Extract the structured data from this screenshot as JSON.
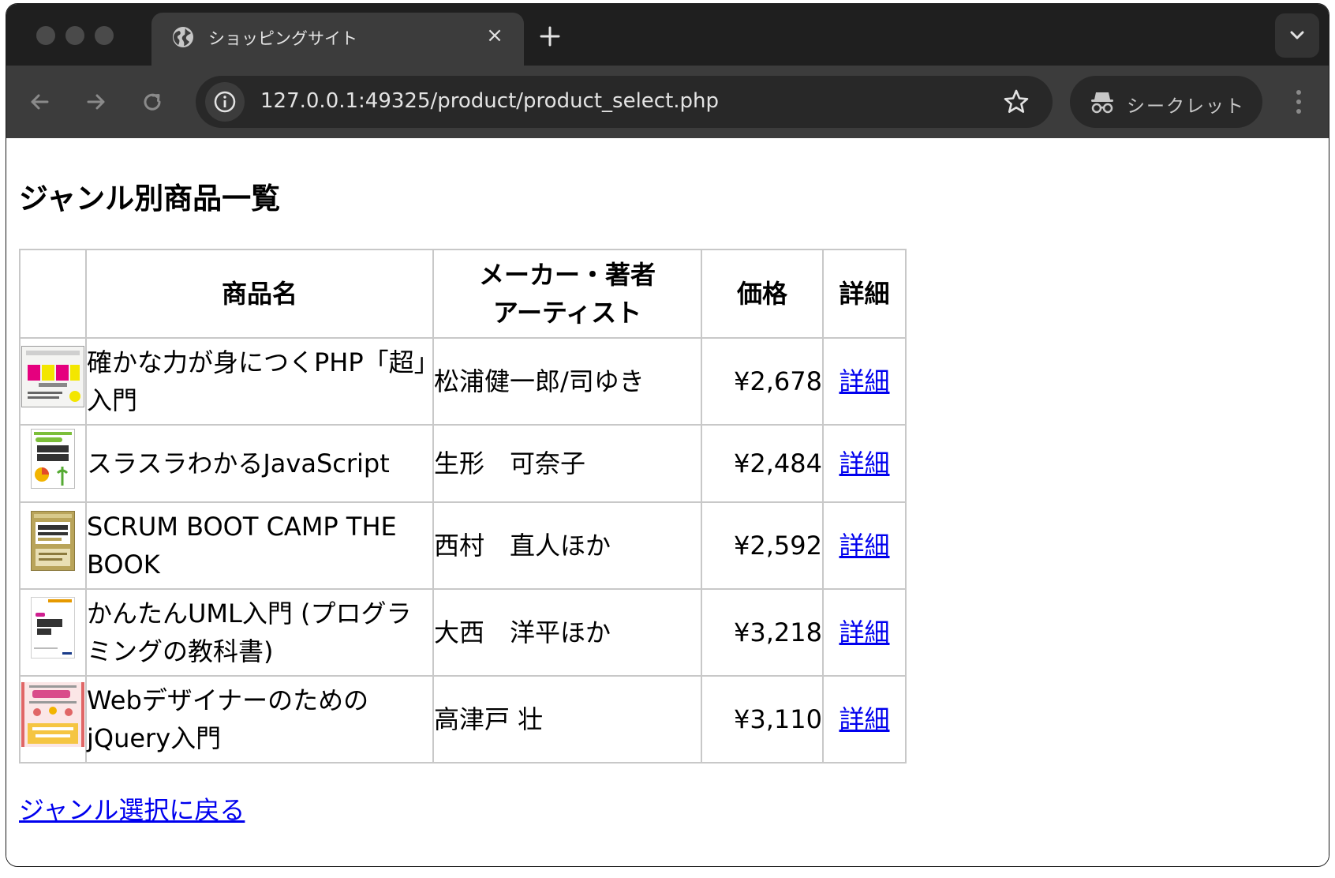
{
  "browser": {
    "tab_title": "ショッピングサイト",
    "url": "127.0.0.1:49325/product/product_select.php",
    "incognito_label": "シークレット",
    "tab_close_glyph": "×",
    "icons": [
      "globe-icon",
      "close-icon",
      "plus-icon",
      "chevron-down-icon",
      "back-arrow-icon",
      "forward-arrow-icon",
      "reload-icon",
      "info-icon",
      "star-icon",
      "incognito-icon",
      "kebab-menu-icon"
    ]
  },
  "page": {
    "title": "ジャンル別商品一覧",
    "table": {
      "headers": {
        "image": "",
        "name": "商品名",
        "maker_line1": "メーカー・著者",
        "maker_line2": "アーティスト",
        "price": "価格",
        "detail": "詳細"
      },
      "rows": [
        {
          "name": "確かな力が身につくPHP「超」入門",
          "maker": "松浦健一郎/司ゆき",
          "price": "¥2,678",
          "detail": "詳細"
        },
        {
          "name": "スラスラわかるJavaScript",
          "maker": "生形　可奈子",
          "price": "¥2,484",
          "detail": "詳細"
        },
        {
          "name": "SCRUM BOOT CAMP THE BOOK",
          "maker": "西村　直人ほか",
          "price": "¥2,592",
          "detail": "詳細"
        },
        {
          "name": "かんたんUML入門 (プログラミングの教科書)",
          "maker": "大西　洋平ほか",
          "price": "¥3,218",
          "detail": "詳細"
        },
        {
          "name": "Webデザイナーのための jQuery入門",
          "maker": "高津戸 壮",
          "price": "¥3,110",
          "detail": "詳細"
        }
      ]
    },
    "back_link": "ジャンル選択に戻る"
  },
  "colors": {
    "tabstrip_bg": "#1f1f1f",
    "toolbar_bg": "#3c3c3c",
    "omnibox_bg": "#282828",
    "link": "#0000ee",
    "table_border": "#c8c8c8"
  }
}
